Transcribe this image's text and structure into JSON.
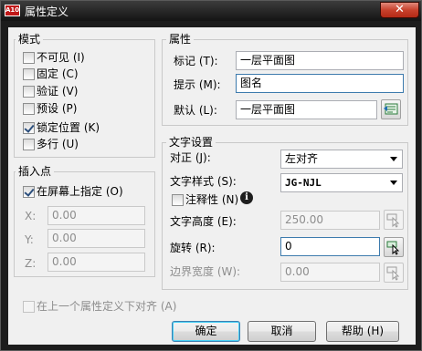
{
  "window": {
    "title": "属性定义",
    "app_icon": "A10",
    "close": "✕"
  },
  "mode": {
    "title": "模式",
    "items": [
      {
        "label": "不可见 (I)",
        "checked": false
      },
      {
        "label": "固定 (C)",
        "checked": false
      },
      {
        "label": "验证 (V)",
        "checked": false
      },
      {
        "label": "预设 (P)",
        "checked": false
      },
      {
        "label": "锁定位置 (K)",
        "checked": true
      },
      {
        "label": "多行 (U)",
        "checked": false
      }
    ]
  },
  "insert": {
    "title": "插入点",
    "on_screen": {
      "label": "在屏幕上指定 (O)",
      "checked": true
    },
    "x": {
      "label": "X:",
      "value": "0.00"
    },
    "y": {
      "label": "Y:",
      "value": "0.00"
    },
    "z": {
      "label": "Z:",
      "value": "0.00"
    }
  },
  "attribute": {
    "title": "属性",
    "tag": {
      "label": "标记 (T):",
      "value": "一层平面图"
    },
    "prompt": {
      "label": "提示 (M):",
      "value": "图名"
    },
    "default": {
      "label": "默认 (L):",
      "value": "一层平面图"
    },
    "field_icon": "insert-field-icon"
  },
  "text": {
    "title": "文字设置",
    "justify": {
      "label": "对正 (J):",
      "value": "左对齐"
    },
    "style": {
      "label": "文字样式 (S):",
      "value": "JG-NJL"
    },
    "annotative": {
      "label": "注释性 (N)",
      "checked": false,
      "info": "i"
    },
    "height": {
      "label": "文字高度 (E):",
      "value": "250.00"
    },
    "rotation": {
      "label": "旋转 (R):",
      "value": "0"
    },
    "boundary": {
      "label": "边界宽度 (W):",
      "value": "0.00"
    }
  },
  "align_below": {
    "label": "在上一个属性定义下对齐 (A)",
    "checked": false
  },
  "buttons": {
    "ok": "确定",
    "cancel": "取消",
    "help": "帮助 (H)"
  }
}
